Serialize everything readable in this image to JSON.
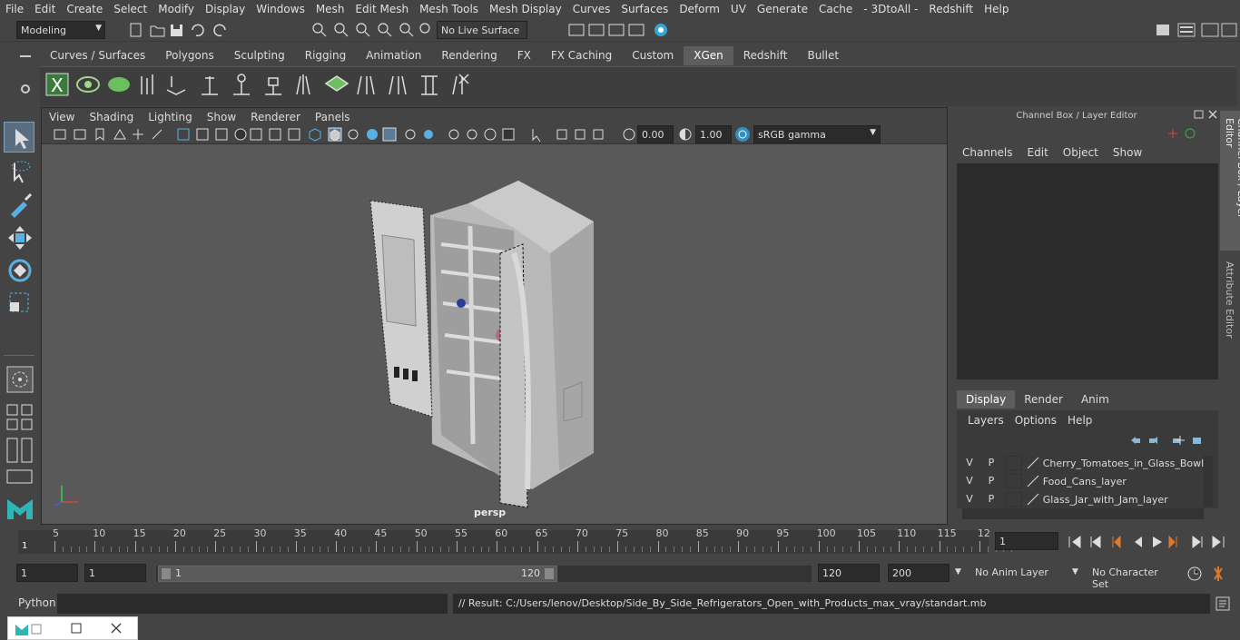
{
  "menubar": {
    "items": [
      "File",
      "Edit",
      "Create",
      "Select",
      "Modify",
      "Display",
      "Windows",
      "Mesh",
      "Edit Mesh",
      "Mesh Tools",
      "Mesh Display",
      "Curves",
      "Surfaces",
      "Deform",
      "UV",
      "Generate",
      "Cache",
      "- 3DtoAll -",
      "Redshift",
      "Help"
    ]
  },
  "statusline": {
    "mode": "Modeling",
    "live_surface": "No Live Surface"
  },
  "shelf": {
    "tabs": [
      "Curves / Surfaces",
      "Polygons",
      "Sculpting",
      "Rigging",
      "Animation",
      "Rendering",
      "FX",
      "FX Caching",
      "Custom",
      "XGen",
      "Redshift",
      "Bullet"
    ],
    "active_tab": "XGen"
  },
  "viewport": {
    "menu": [
      "View",
      "Shading",
      "Lighting",
      "Show",
      "Renderer",
      "Panels"
    ],
    "exposure": "0.00",
    "gamma": "1.00",
    "color_space": "sRGB gamma",
    "camera_label": "persp"
  },
  "channel_box": {
    "title": "Channel Box / Layer Editor",
    "menu": [
      "Channels",
      "Edit",
      "Object",
      "Show"
    ],
    "side_tabs": [
      "Channel Box / Layer Editor",
      "Attribute Editor"
    ],
    "layer_tabs": [
      "Display",
      "Render",
      "Anim"
    ],
    "active_layer_tab": "Display",
    "layer_menu": [
      "Layers",
      "Options",
      "Help"
    ],
    "layers": [
      {
        "v": "V",
        "p": "P",
        "name": "Cherry_Tomatoes_in_Glass_Bowl_Fr"
      },
      {
        "v": "V",
        "p": "P",
        "name": "Food_Cans_layer"
      },
      {
        "v": "V",
        "p": "P",
        "name": "Glass_Jar_with_Jam_layer"
      }
    ]
  },
  "timeline": {
    "ticks": [
      "5",
      "10",
      "15",
      "20",
      "25",
      "30",
      "35",
      "40",
      "45",
      "50",
      "55",
      "60",
      "65",
      "70",
      "75",
      "80",
      "85",
      "90",
      "95",
      "100",
      "105",
      "110",
      "115",
      "12"
    ],
    "start_marker": "1",
    "current_frame": "1"
  },
  "range": {
    "start": "1",
    "start2": "1",
    "slider_start": "1",
    "slider_end": "120",
    "end": "120",
    "end2": "200",
    "anim_layer": "No Anim Layer",
    "character_set": "No Character Set"
  },
  "cmdline": {
    "lang": "Python",
    "result": "// Result: C:/Users/lenov/Desktop/Side_By_Side_Refrigerators_Open_with_Products_max_vray/standart.mb"
  }
}
